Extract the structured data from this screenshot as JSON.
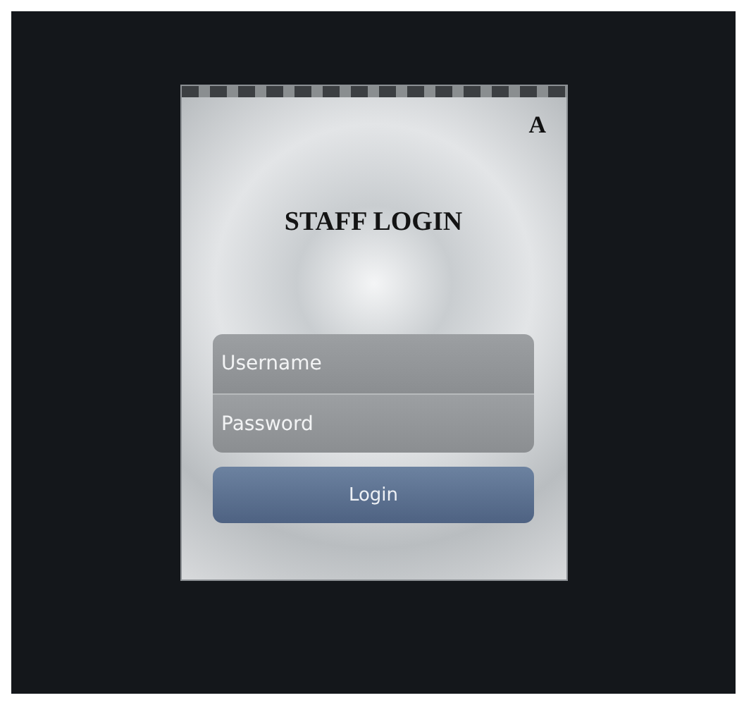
{
  "card": {
    "corner_mark": "A",
    "title": "STAFF LOGIN"
  },
  "fields": [
    {
      "placeholder": "Username"
    },
    {
      "placeholder": "Password"
    }
  ],
  "login_button": {
    "label": "Login"
  }
}
